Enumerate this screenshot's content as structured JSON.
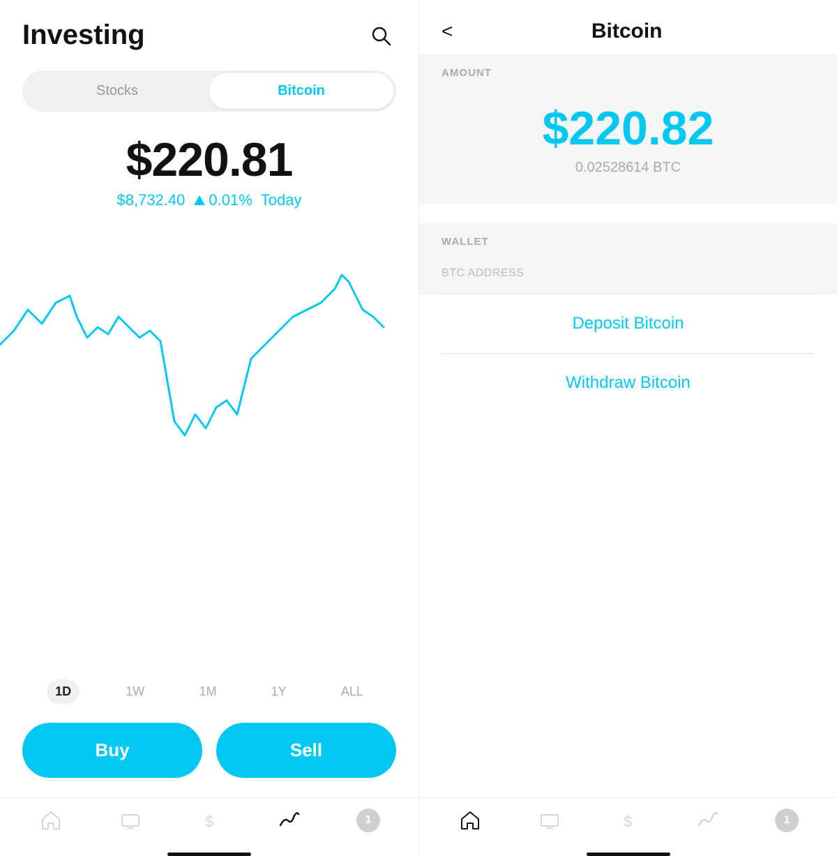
{
  "left": {
    "header": {
      "title": "Investing",
      "search_icon": "🔍"
    },
    "tabs": [
      {
        "label": "Stocks",
        "active": false
      },
      {
        "label": "Bitcoin",
        "active": true
      }
    ],
    "price": {
      "main": "$220.81",
      "sub": "$8,732.40",
      "change": "0.01%",
      "period": "Today"
    },
    "time_filters": [
      {
        "label": "1D",
        "active": true
      },
      {
        "label": "1W",
        "active": false
      },
      {
        "label": "1M",
        "active": false
      },
      {
        "label": "1Y",
        "active": false
      },
      {
        "label": "ALL",
        "active": false
      }
    ],
    "buttons": {
      "buy": "Buy",
      "sell": "Sell"
    },
    "nav": [
      {
        "icon": "home",
        "active": false
      },
      {
        "icon": "tv",
        "active": false
      },
      {
        "icon": "dollar",
        "active": false
      },
      {
        "icon": "chart",
        "active": true
      },
      {
        "icon": "badge",
        "label": "1",
        "active": false
      }
    ]
  },
  "right": {
    "header": {
      "back": "<",
      "title": "Bitcoin"
    },
    "amount_section": {
      "label": "AMOUNT",
      "value": "$220.82",
      "btc": "0.02528614 BTC"
    },
    "wallet_section": {
      "label": "WALLET",
      "btc_address_label": "BTC ADDRESS"
    },
    "actions": [
      {
        "label": "Deposit Bitcoin"
      },
      {
        "label": "Withdraw Bitcoin"
      }
    ],
    "nav": [
      {
        "icon": "home",
        "active": true
      },
      {
        "icon": "tv",
        "active": false
      },
      {
        "icon": "dollar",
        "active": false
      },
      {
        "icon": "chart",
        "active": false
      },
      {
        "icon": "badge",
        "label": "1",
        "active": false
      }
    ]
  }
}
